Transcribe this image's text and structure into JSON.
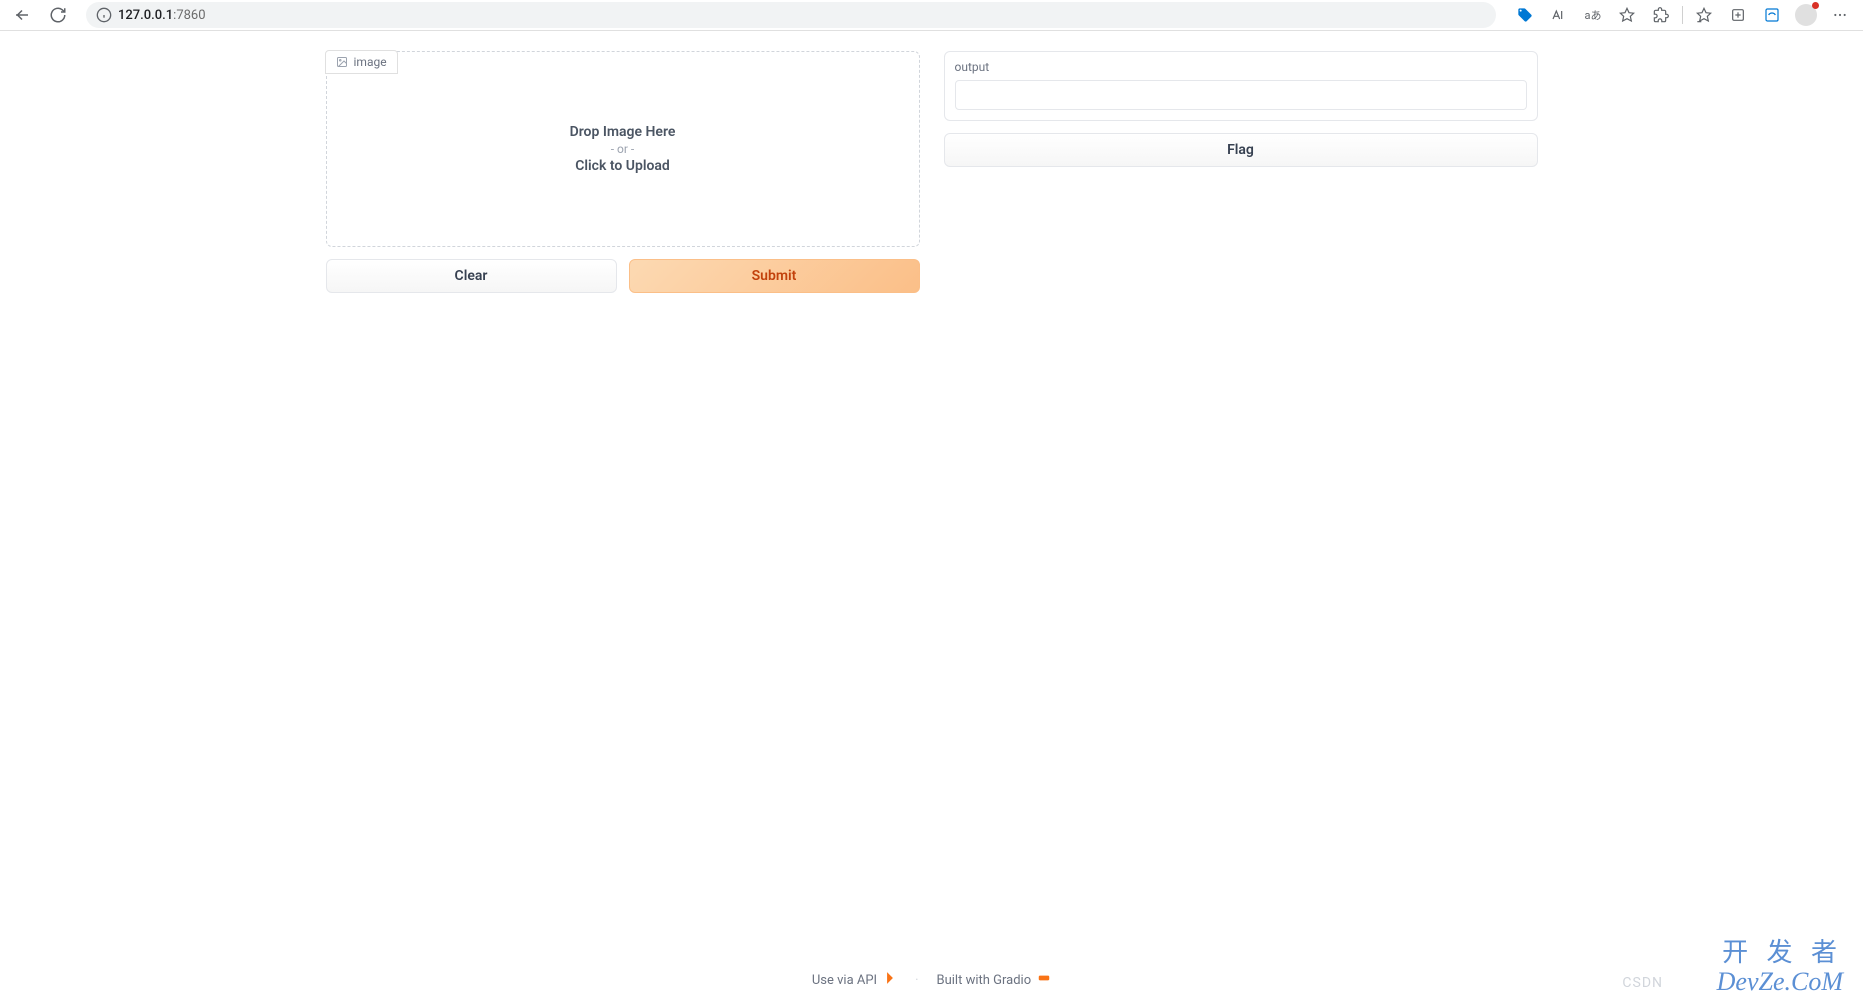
{
  "browser": {
    "url_host": "127.0.0.1",
    "url_port": ":7860"
  },
  "input": {
    "tab_label": "image",
    "drop_line1": "Drop Image Here",
    "drop_or": "- or -",
    "drop_line2": "Click to Upload"
  },
  "buttons": {
    "clear": "Clear",
    "submit": "Submit",
    "flag": "Flag"
  },
  "output": {
    "label": "output",
    "value": ""
  },
  "footer": {
    "api_text": "Use via API",
    "sep": "·",
    "built_text": "Built with Gradio"
  },
  "watermarks": {
    "csdn": "CSDN",
    "cn": "开 发 者",
    "devze": "DevZe.CoM"
  }
}
